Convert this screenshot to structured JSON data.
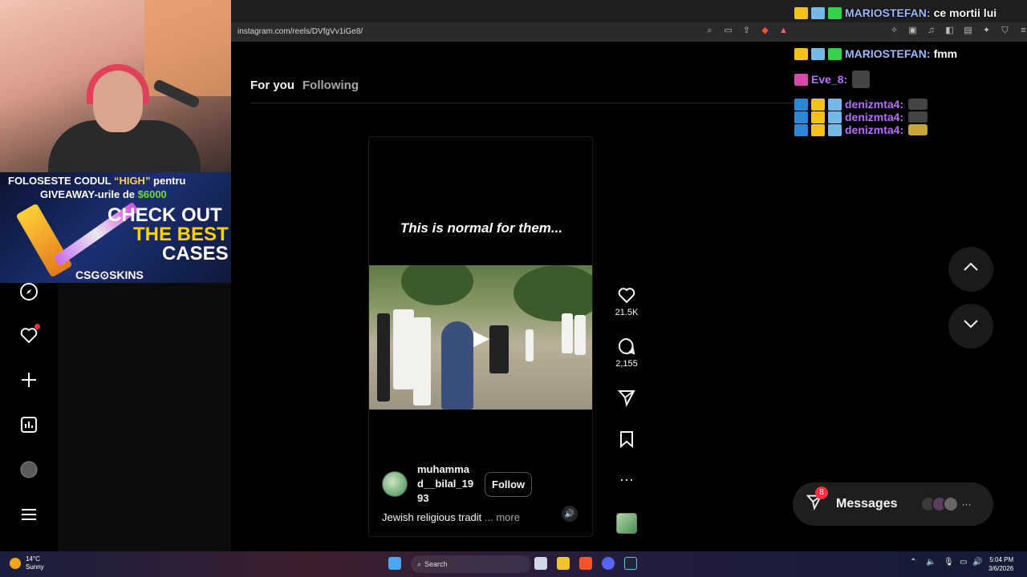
{
  "browser": {
    "url": "instagram.com/reels/DVfgVv1iGe8/"
  },
  "instagram": {
    "tabs": [
      "For you",
      "Following"
    ],
    "reel": {
      "overlay_caption": "This is normal for them...",
      "username": "muhammad__bilal_1993",
      "follow_label": "Follow",
      "description": "Jewish religious tradit",
      "more_label": "... more",
      "likes": "21.5K",
      "comments": "2,155"
    },
    "messages": {
      "label": "Messages",
      "badge": "8"
    }
  },
  "stream_overlay": {
    "ad": {
      "line1_prefix": "FOLOSESTE CODUL ",
      "line1_code": "“HIGH”",
      "line1_suffix": " pentru",
      "line2_prefix": "GIVEAWAY-urile de ",
      "line2_amount": "$6000",
      "big1": "CHECK OUT",
      "big2": "THE BEST",
      "big3": "CASES",
      "brand": "CSG⊙SKINS"
    },
    "chat": [
      {
        "user": "MARIOSTEFAN:",
        "text": "ce mortii lui"
      },
      {
        "user": "MARIOSTEFAN:",
        "text": "fmm"
      },
      {
        "user": "Eve_8:",
        "text": ""
      },
      {
        "user": "denizmta4:",
        "text": ""
      },
      {
        "user": "denizmta4:",
        "text": ""
      },
      {
        "user": "denizmta4:",
        "text": ""
      }
    ]
  },
  "taskbar": {
    "weather_temp": "14°C",
    "weather_desc": "Sunny",
    "search_label": "Search",
    "time": "5:04 PM",
    "date": "3/6/2026"
  },
  "colors": {
    "accent_red": "#ff3040",
    "chat_name_blue": "#9ab9ff",
    "chat_name_purple": "#b76cff"
  }
}
